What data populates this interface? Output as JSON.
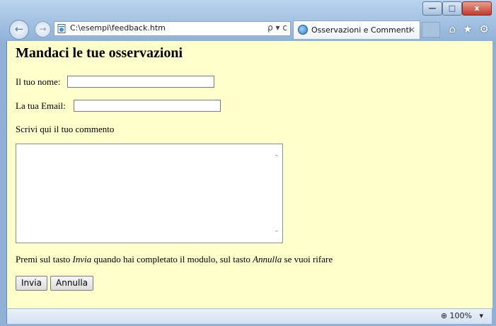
{
  "browser": {
    "address": "C:\\esempi\\feedback.htm",
    "address_tools": "ρ ▾ c",
    "tab_title": "Osservazioni e Commenti",
    "tab_close": "×",
    "back_glyph": "←",
    "forward_glyph": "→",
    "window_buttons": {
      "minimize": "—",
      "maximize": "□",
      "close": "x"
    },
    "toolbar_icons": [
      "home-icon",
      "favorites-star-icon",
      "tools-gear-icon"
    ],
    "zoom": "100%"
  },
  "page": {
    "heading": "Mandaci le tue osservazioni",
    "name_label": "Il tuo nome:",
    "name_value": "",
    "email_label": "La tua Email:",
    "email_value": "",
    "comment_label": "Scrivi qui il tuo commento",
    "comment_value": "",
    "note_part1": "Premi sul tasto ",
    "note_em1": "Invia",
    "note_part2": " quando hai completato il modulo, sul tasto ",
    "note_em2": "Annulla",
    "note_part3": " se vuoi rifare",
    "submit_label": "Invia",
    "reset_label": "Annulla"
  },
  "colors": {
    "page_background": "#ffffcc",
    "frame": "#8fb1d6",
    "close_button": "#c0392b"
  }
}
